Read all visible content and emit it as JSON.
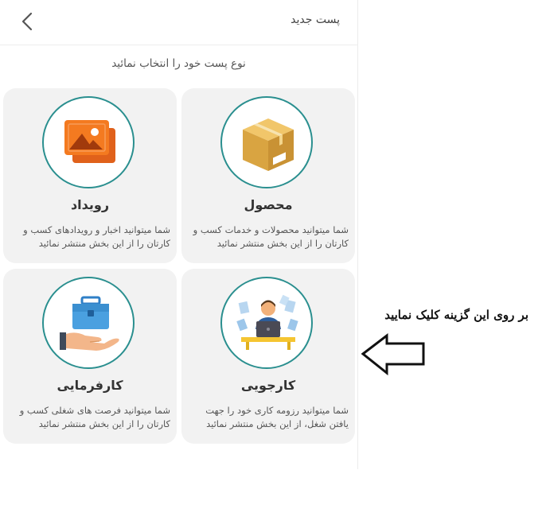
{
  "header": {
    "title": "پست جدید",
    "back_icon": "chevron-left-icon"
  },
  "subtitle": "نوع پست خود را انتخاب نمائید",
  "cards": [
    {
      "title": "محصول",
      "description": "شما میتوانید محصولات و خدمات کسب و کارتان را از این بخش منتشر نمائید",
      "icon": "box-icon"
    },
    {
      "title": "رویداد",
      "description": "شما میتوانید اخبار و رویدادهای کسب و کارتان را از این بخش منتشر نمائید",
      "icon": "images-icon"
    },
    {
      "title": "کارجویی",
      "description": "شما میتوانید رزومه کاری خود را جهت یافتن شغل، از این بخش منتشر نمائید",
      "icon": "job-seeker-icon"
    },
    {
      "title": "کارفرمایی",
      "description": "شما میتوانید فرصت های شغلی کسب و کارتان را از این بخش منتشر نمائید",
      "icon": "briefcase-hand-icon"
    }
  ],
  "annotation": {
    "text": "بر روی این گزینه کلیک نمایید",
    "arrow_icon": "arrow-left-outline-icon"
  },
  "colors": {
    "accent_circle": "#2a8f8f",
    "card_background": "#f2f2f2"
  }
}
